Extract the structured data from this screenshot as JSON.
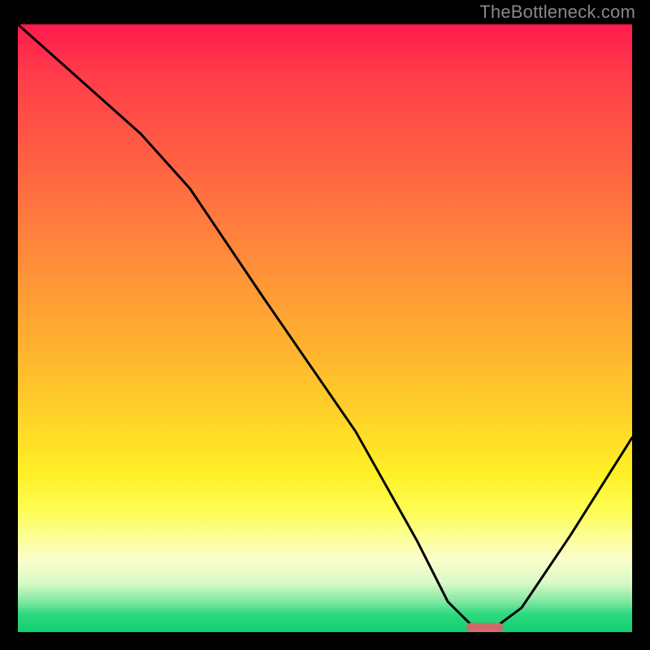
{
  "watermark": "TheBottleneck.com",
  "chart_data": {
    "type": "line",
    "title": "",
    "xlabel": "",
    "ylabel": "",
    "xlim": [
      0,
      100
    ],
    "ylim": [
      0,
      100
    ],
    "background_gradient_stops": [
      {
        "pos": 0,
        "color": "#ff1a4d"
      },
      {
        "pos": 20,
        "color": "#ff5a44"
      },
      {
        "pos": 44,
        "color": "#ff9a36"
      },
      {
        "pos": 66,
        "color": "#ffd728"
      },
      {
        "pos": 80,
        "color": "#fdfd54"
      },
      {
        "pos": 92,
        "color": "#d7f9c6"
      },
      {
        "pos": 100,
        "color": "#11cf6e"
      }
    ],
    "series": [
      {
        "name": "bottleneck-curve",
        "x": [
          0,
          10,
          20,
          28,
          40,
          55,
          65,
          70,
          74,
          78,
          82,
          90,
          100
        ],
        "values": [
          100,
          91,
          82,
          73,
          55,
          33,
          15,
          5,
          1,
          1,
          4,
          16,
          32
        ]
      }
    ],
    "marker": {
      "name": "optimal-point",
      "x": 76,
      "y": 0.8,
      "width": 6,
      "height": 1.4,
      "color": "#d06a6a"
    },
    "annotations": []
  }
}
